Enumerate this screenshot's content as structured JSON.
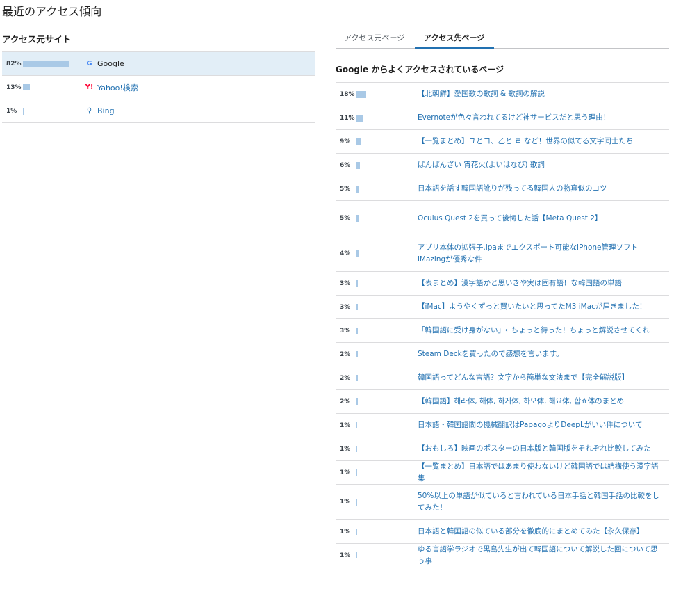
{
  "page": {
    "title": "最近のアクセス傾向"
  },
  "referrers": {
    "heading": "アクセス元サイト",
    "items": [
      {
        "pct": "82%",
        "value": 0.82,
        "icon": "google-icon",
        "glyph": "G",
        "color": "#4285f4",
        "name": "Google",
        "selected": true
      },
      {
        "pct": "13%",
        "value": 0.13,
        "icon": "yahoo-icon",
        "glyph": "Y!",
        "color": "#ff0033",
        "name": "Yahoo!検索",
        "selected": false
      },
      {
        "pct": "1%",
        "value": 0.01,
        "icon": "bing-search-icon",
        "glyph": "⚲",
        "color": "#2271b1",
        "name": "Bing",
        "selected": false
      }
    ]
  },
  "tabs": [
    {
      "label": "アクセス元ページ",
      "active": false
    },
    {
      "label": "アクセス先ページ",
      "active": true
    }
  ],
  "destinations": {
    "heading": "Google からよくアクセスされているページ",
    "items": [
      {
        "pct": "18%",
        "value": 0.18,
        "title": "【北朝鮮】愛国歌の歌詞 & 歌詞の解説"
      },
      {
        "pct": "11%",
        "value": 0.11,
        "title": "Evernoteが色々言われてるけど神サービスだと思う理由！"
      },
      {
        "pct": "9%",
        "value": 0.09,
        "title": "【一覧まとめ】ユとコ、乙と ㄹ など！世界の似てる文字同士たち"
      },
      {
        "pct": "6%",
        "value": 0.06,
        "title": "ぱんぱんざい 宵花火(よいはなび) 歌詞"
      },
      {
        "pct": "5%",
        "value": 0.05,
        "title": "日本語を話す韓国語訛りが残ってる韓国人の物真似のコツ"
      },
      {
        "pct": "5%",
        "value": 0.05,
        "title": "Oculus Quest 2を買って後悔した話【Meta Quest 2】"
      },
      {
        "pct": "4%",
        "value": 0.04,
        "title": "アプリ本体の拡張子.ipaまでエクスポート可能なiPhone管理ソフトiMazingが優秀な件"
      },
      {
        "pct": "3%",
        "value": 0.03,
        "title": "【表まとめ】漢字語かと思いきや実は固有語！な韓国語の単語"
      },
      {
        "pct": "3%",
        "value": 0.03,
        "title": "【iMac】ようやくずっと買いたいと思ってたM3 iMacが届きました！"
      },
      {
        "pct": "3%",
        "value": 0.03,
        "title": "「韓国語に受け身がない」←ちょっと待った！ちょっと解説させてくれ"
      },
      {
        "pct": "2%",
        "value": 0.02,
        "title": "Steam Deckを買ったので感想を言います。"
      },
      {
        "pct": "2%",
        "value": 0.02,
        "title": "韓国語ってどんな言語？文字から簡単な文法まで【完全解説版】"
      },
      {
        "pct": "2%",
        "value": 0.02,
        "title": "【韓国語】해라体, 해体, 하게体, 하오体, 해요体, 합쇼体のまとめ"
      },
      {
        "pct": "1%",
        "value": 0.01,
        "title": "日本語・韓国語間の機械翻訳はPapagoよりDeepLがいい件について"
      },
      {
        "pct": "1%",
        "value": 0.01,
        "title": "【おもしろ】映画のポスターの日本版と韓国版をそれぞれ比較してみた"
      },
      {
        "pct": "1%",
        "value": 0.01,
        "title": "【一覧まとめ】日本語ではあまり使わないけど韓国語では結構使う漢字語集"
      },
      {
        "pct": "1%",
        "value": 0.01,
        "title": "50%以上の単語が似ていると言われている日本手話と韓国手話の比較をしてみた！"
      },
      {
        "pct": "1%",
        "value": 0.01,
        "title": "日本語と韓国語の似ている部分を徹底的にまとめてみた【永久保存】"
      },
      {
        "pct": "1%",
        "value": 0.01,
        "title": "ゆる言語学ラジオで黒島先生が出て韓国語について解説した回について思う事"
      }
    ]
  }
}
